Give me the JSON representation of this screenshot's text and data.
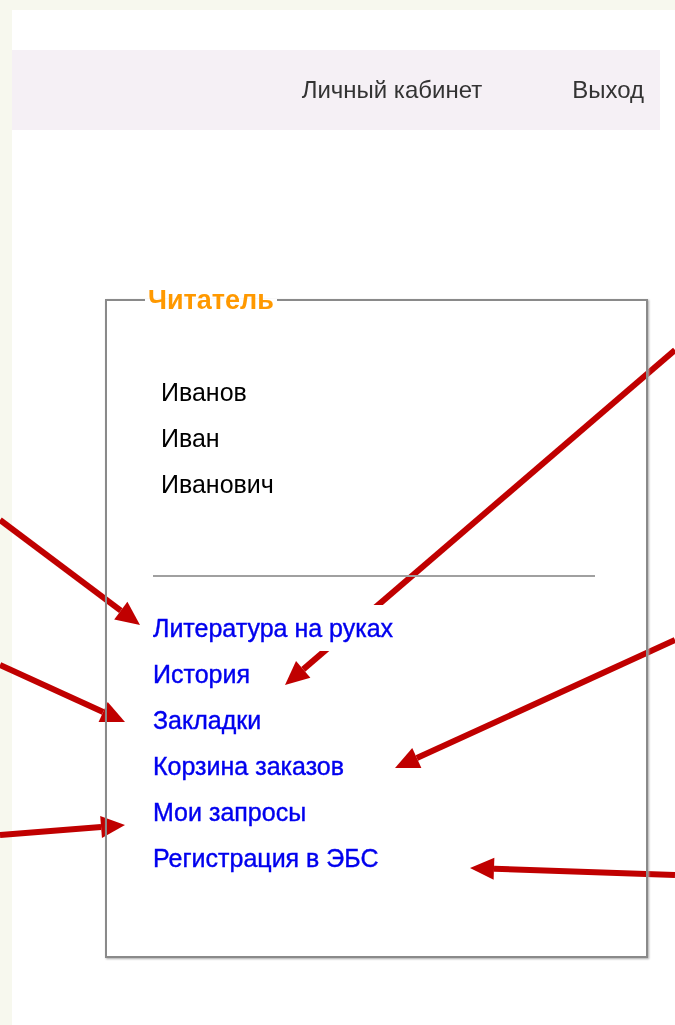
{
  "header": {
    "links": [
      "Личный кабинет",
      "Выход"
    ]
  },
  "reader_panel": {
    "legend": "Читатель",
    "name_lines": [
      "Иванов",
      "Иван",
      "Иванович"
    ],
    "links": [
      "Литература на руках",
      "История",
      "Закладки",
      "Корзина заказов",
      "Мои запросы",
      "Регистрация в ЭБС"
    ]
  }
}
